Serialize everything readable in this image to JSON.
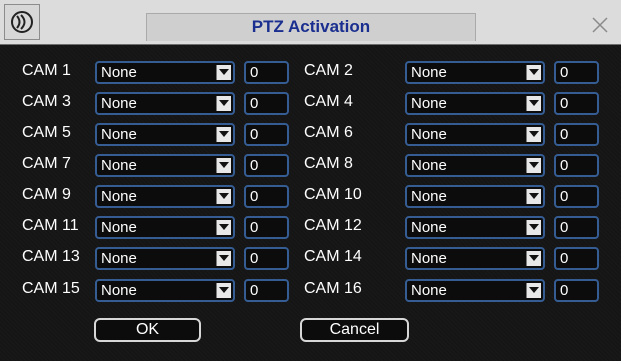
{
  "window": {
    "title": "PTZ Activation",
    "logo_icon": "logo-icon",
    "close_icon": "close-icon"
  },
  "rows": [
    {
      "left": {
        "label": "CAM 1",
        "select": "None",
        "value": "0"
      },
      "right": {
        "label": "CAM 2",
        "select": "None",
        "value": "0"
      }
    },
    {
      "left": {
        "label": "CAM 3",
        "select": "None",
        "value": "0"
      },
      "right": {
        "label": "CAM 4",
        "select": "None",
        "value": "0"
      }
    },
    {
      "left": {
        "label": "CAM 5",
        "select": "None",
        "value": "0"
      },
      "right": {
        "label": "CAM 6",
        "select": "None",
        "value": "0"
      }
    },
    {
      "left": {
        "label": "CAM 7",
        "select": "None",
        "value": "0"
      },
      "right": {
        "label": "CAM 8",
        "select": "None",
        "value": "0"
      }
    },
    {
      "left": {
        "label": "CAM 9",
        "select": "None",
        "value": "0"
      },
      "right": {
        "label": "CAM 10",
        "select": "None",
        "value": "0"
      }
    },
    {
      "left": {
        "label": "CAM 11",
        "select": "None",
        "value": "0"
      },
      "right": {
        "label": "CAM 12",
        "select": "None",
        "value": "0"
      }
    },
    {
      "left": {
        "label": "CAM 13",
        "select": "None",
        "value": "0"
      },
      "right": {
        "label": "CAM 14",
        "select": "None",
        "value": "0"
      }
    },
    {
      "left": {
        "label": "CAM 15",
        "select": "None",
        "value": "0"
      },
      "right": {
        "label": "CAM 16",
        "select": "None",
        "value": "0"
      }
    }
  ],
  "buttons": {
    "ok": "OK",
    "cancel": "Cancel"
  },
  "colors": {
    "title_text": "#1a2f8f",
    "field_border": "#355d93",
    "background": "#151515"
  }
}
